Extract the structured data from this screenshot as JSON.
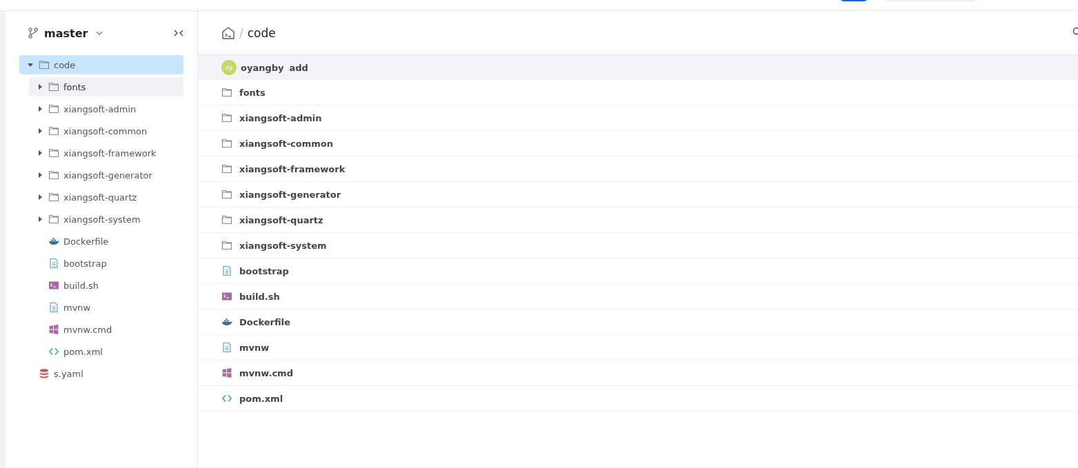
{
  "branch": {
    "name": "master"
  },
  "tree": [
    {
      "name": "code",
      "kind": "folder",
      "expanded": true,
      "selected": true,
      "hovered": false,
      "children": [
        {
          "name": "fonts",
          "kind": "folder",
          "expanded": false,
          "selected": false,
          "hovered": true
        },
        {
          "name": "xiangsoft-admin",
          "kind": "folder",
          "expanded": false,
          "selected": false,
          "hovered": false
        },
        {
          "name": "xiangsoft-common",
          "kind": "folder",
          "expanded": false,
          "selected": false,
          "hovered": false
        },
        {
          "name": "xiangsoft-framework",
          "kind": "folder",
          "expanded": false,
          "selected": false,
          "hovered": false
        },
        {
          "name": "xiangsoft-generator",
          "kind": "folder",
          "expanded": false,
          "selected": false,
          "hovered": false
        },
        {
          "name": "xiangsoft-quartz",
          "kind": "folder",
          "expanded": false,
          "selected": false,
          "hovered": false
        },
        {
          "name": "xiangsoft-system",
          "kind": "folder",
          "expanded": false,
          "selected": false,
          "hovered": false
        },
        {
          "name": "Dockerfile",
          "kind": "docker",
          "selected": false,
          "hovered": false
        },
        {
          "name": "bootstrap",
          "kind": "text",
          "selected": false,
          "hovered": false
        },
        {
          "name": "build.sh",
          "kind": "shell",
          "selected": false,
          "hovered": false
        },
        {
          "name": "mvnw",
          "kind": "text",
          "selected": false,
          "hovered": false
        },
        {
          "name": "mvnw.cmd",
          "kind": "windows",
          "selected": false,
          "hovered": false
        },
        {
          "name": "pom.xml",
          "kind": "code",
          "selected": false,
          "hovered": false
        }
      ]
    },
    {
      "name": "s.yaml",
      "kind": "database",
      "selected": false,
      "hovered": false
    }
  ],
  "breadcrumb": {
    "separator": "/",
    "current": "code"
  },
  "commit": {
    "avatar": "oy",
    "author": "oyangby",
    "message": "add"
  },
  "files": [
    {
      "name": "fonts",
      "kind": "folder"
    },
    {
      "name": "xiangsoft-admin",
      "kind": "folder"
    },
    {
      "name": "xiangsoft-common",
      "kind": "folder"
    },
    {
      "name": "xiangsoft-framework",
      "kind": "folder"
    },
    {
      "name": "xiangsoft-generator",
      "kind": "folder"
    },
    {
      "name": "xiangsoft-quartz",
      "kind": "folder"
    },
    {
      "name": "xiangsoft-system",
      "kind": "folder"
    },
    {
      "name": "bootstrap",
      "kind": "text"
    },
    {
      "name": "build.sh",
      "kind": "shell"
    },
    {
      "name": "Dockerfile",
      "kind": "docker"
    },
    {
      "name": "mvnw",
      "kind": "text"
    },
    {
      "name": "mvnw.cmd",
      "kind": "windows"
    },
    {
      "name": "pom.xml",
      "kind": "code"
    }
  ]
}
